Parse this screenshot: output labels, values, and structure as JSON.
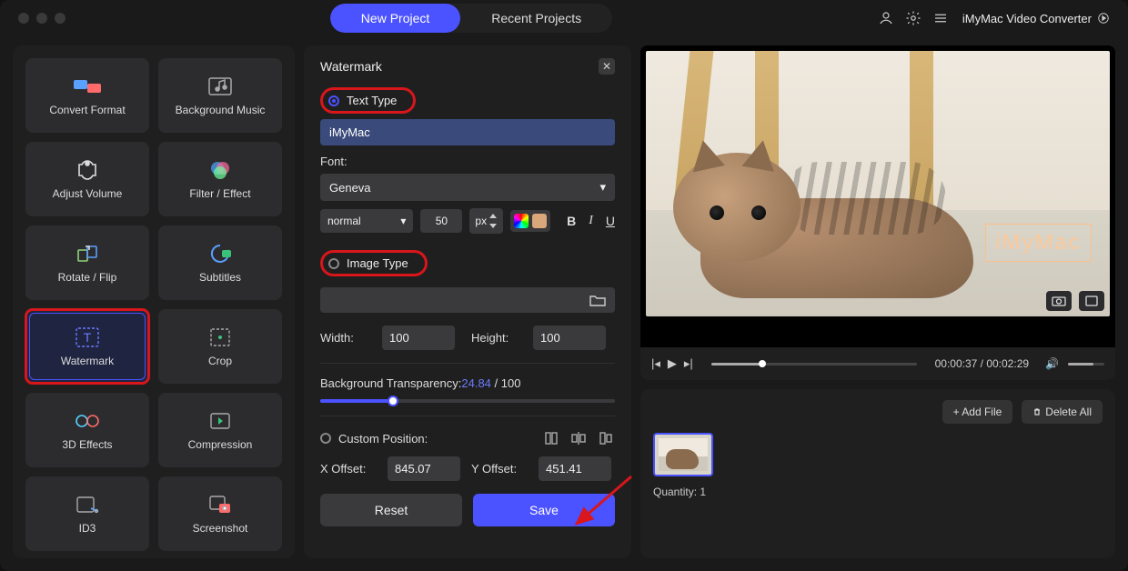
{
  "header": {
    "tab_new": "New Project",
    "tab_recent": "Recent Projects",
    "app_name": "iMyMac Video Converter"
  },
  "sidebar": {
    "items": [
      {
        "label": "Convert Format"
      },
      {
        "label": "Background Music"
      },
      {
        "label": "Adjust Volume"
      },
      {
        "label": "Filter / Effect"
      },
      {
        "label": "Rotate / Flip"
      },
      {
        "label": "Subtitles"
      },
      {
        "label": "Watermark"
      },
      {
        "label": "Crop"
      },
      {
        "label": "3D Effects"
      },
      {
        "label": "Compression"
      },
      {
        "label": "ID3"
      },
      {
        "label": "Screenshot"
      }
    ]
  },
  "panel": {
    "title": "Watermark",
    "text_type_label": "Text Type",
    "watermark_text": "iMyMac",
    "font_label": "Font:",
    "font_value": "Geneva",
    "weight_value": "normal",
    "size_value": "50",
    "size_unit": "px",
    "image_type_label": "Image Type",
    "width_label": "Width:",
    "width_value": "100",
    "height_label": "Height:",
    "height_value": "100",
    "bg_trans_label": "Background Transparency:",
    "bg_trans_value": "24.84",
    "bg_trans_max": " / 100",
    "custom_pos_label": "Custom Position:",
    "xoff_label": "X Offset:",
    "xoff_value": "845.07",
    "yoff_label": "Y Offset:",
    "yoff_value": "451.41",
    "reset": "Reset",
    "save": "Save"
  },
  "preview": {
    "overlay_text": "iMyMac",
    "time_current": "00:00:37",
    "time_total": "00:02:29",
    "time_sep": " / "
  },
  "files": {
    "add": "+ Add File",
    "delete": "Delete All",
    "quantity_label": "Quantity: ",
    "quantity_value": "1"
  },
  "colors": {
    "accent": "#4b52ff",
    "highlight": "#d8161b"
  }
}
